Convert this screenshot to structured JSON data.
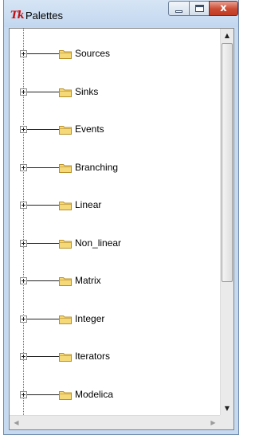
{
  "window": {
    "title": "Palettes",
    "app_icon_text": "Tk",
    "close_glyph": "x"
  },
  "tree": {
    "items": [
      {
        "label": "Sources"
      },
      {
        "label": "Sinks"
      },
      {
        "label": "Events"
      },
      {
        "label": "Branching"
      },
      {
        "label": "Linear"
      },
      {
        "label": "Non_linear"
      },
      {
        "label": "Matrix"
      },
      {
        "label": "Integer"
      },
      {
        "label": "Iterators"
      },
      {
        "label": "Modelica"
      }
    ]
  },
  "scrollbars": {
    "up_glyph": "▲",
    "down_glyph": "▼",
    "left_glyph": "◀",
    "right_glyph": "▶"
  },
  "colors": {
    "folder_fill": "#f5d878",
    "folder_edge": "#b8902a",
    "titlebar": "#c5d9f0",
    "close_button": "#c8432b"
  },
  "icons": {
    "tree_node": "folder-icon",
    "expander": "plus-box-icon"
  }
}
